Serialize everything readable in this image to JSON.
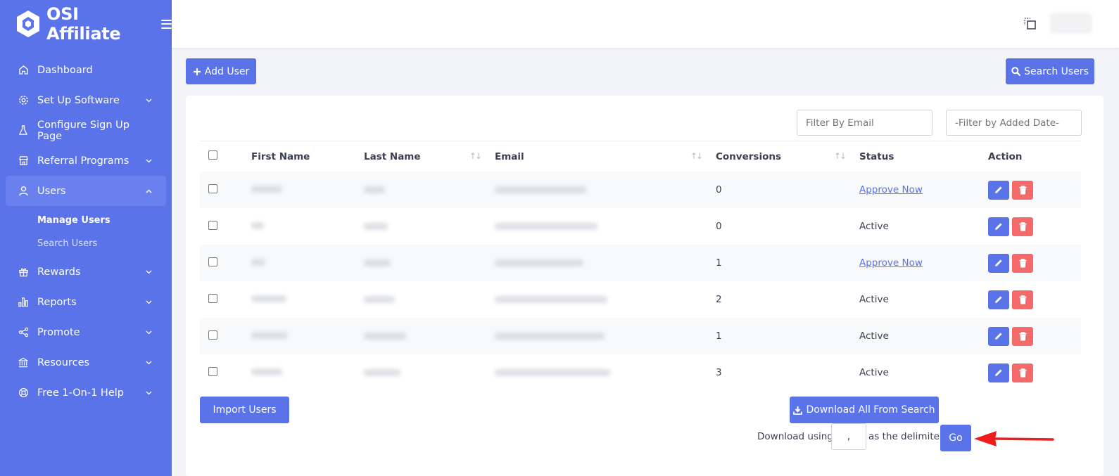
{
  "brand": {
    "name": "OSI Affiliate",
    "logo_icon": "hexagon-logo-icon"
  },
  "sidebar": {
    "items": [
      {
        "label": "Dashboard",
        "icon": "home-icon",
        "has_chevron": false
      },
      {
        "label": "Set Up Software",
        "icon": "gear-icon",
        "has_chevron": true
      },
      {
        "label": "Configure Sign Up Page",
        "icon": "flask-icon",
        "has_chevron": false
      },
      {
        "label": "Referral Programs",
        "icon": "store-icon",
        "has_chevron": true
      },
      {
        "label": "Users",
        "icon": "user-icon",
        "has_chevron": true,
        "active": true
      },
      {
        "label": "Rewards",
        "icon": "gift-icon",
        "has_chevron": true
      },
      {
        "label": "Reports",
        "icon": "bar-chart-icon",
        "has_chevron": true
      },
      {
        "label": "Promote",
        "icon": "share-icon",
        "has_chevron": true
      },
      {
        "label": "Resources",
        "icon": "bank-icon",
        "has_chevron": true
      },
      {
        "label": "Free 1-On-1 Help",
        "icon": "lifebuoy-icon",
        "has_chevron": true
      }
    ],
    "users_sub": [
      {
        "label": "Manage Users",
        "current": true
      },
      {
        "label": "Search Users",
        "current": false
      }
    ]
  },
  "toolbar": {
    "add_user": "Add User",
    "search_users": "Search Users"
  },
  "filters": {
    "email_placeholder": "Filter By Email",
    "date_placeholder": "-Filter by Added Date-"
  },
  "table": {
    "columns": [
      "First Name",
      "Last Name",
      "Email",
      "Conversions",
      "Status",
      "Action"
    ],
    "rows": [
      {
        "conversions": "0",
        "status": "Approve Now",
        "link": true
      },
      {
        "conversions": "0",
        "status": "Active",
        "link": false
      },
      {
        "conversions": "1",
        "status": "Approve Now",
        "link": true
      },
      {
        "conversions": "2",
        "status": "Active",
        "link": false
      },
      {
        "conversions": "1",
        "status": "Active",
        "link": false
      },
      {
        "conversions": "3",
        "status": "Active",
        "link": false
      }
    ]
  },
  "footer": {
    "import_users": "Import Users",
    "download_all": "Download All From Search",
    "download_using": "Download using",
    "delimiter_value": ",",
    "as_the_delimiter": "as the delimiter",
    "go": "Go"
  },
  "colors": {
    "primary": "#5b73e8",
    "danger": "#f46a6a",
    "arrow": "#ee1c1c"
  }
}
